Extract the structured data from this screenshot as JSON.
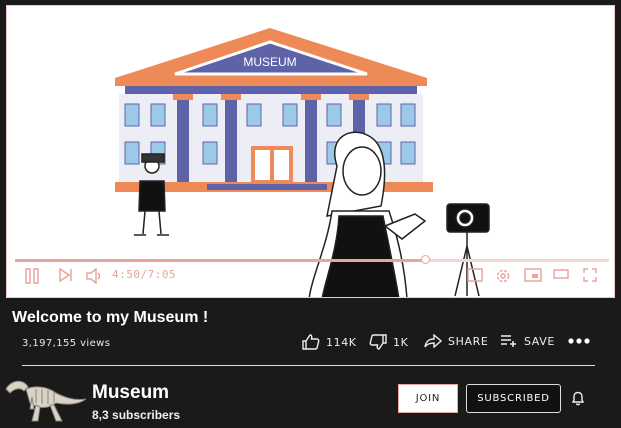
{
  "player": {
    "time": "4:50/7:05",
    "progress_fraction": 0.69,
    "building_sign": "MUSEUM",
    "accent_color": "#e7a59d"
  },
  "video": {
    "title": "Welcome to my Museum !",
    "views": "3,197,155 views",
    "actions": {
      "like_count": "114K",
      "dislike_count": "1K",
      "share_label": "SHARE",
      "save_label": "SAVE"
    }
  },
  "channel": {
    "name": "Museum",
    "subscribers": "8,3 subscribers",
    "join_label": "JOIN",
    "subscribed_label": "SUBSCRIBED"
  },
  "icons": [
    "play-pause-icon",
    "next-icon",
    "volume-icon",
    "settings-icon",
    "miniplayer-icon",
    "theater-icon",
    "fullscreen-icon",
    "like-icon",
    "dislike-icon",
    "share-icon",
    "save-icon",
    "more-icon",
    "bell-icon"
  ]
}
